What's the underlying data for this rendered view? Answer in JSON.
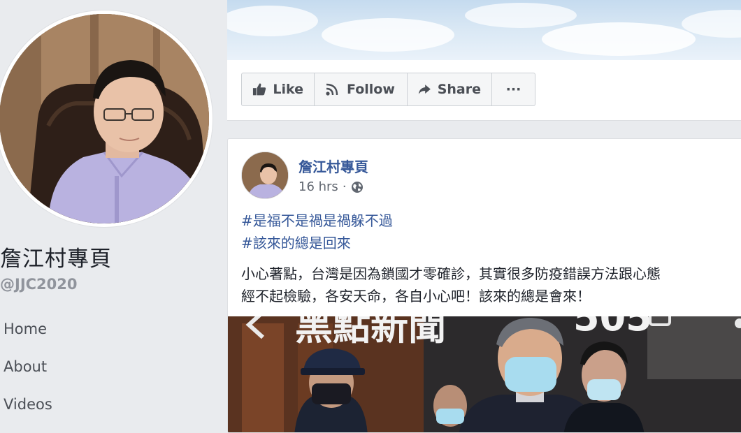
{
  "sidebar": {
    "page_name": "詹江村專頁",
    "handle": "@JJC2020",
    "nav": [
      "Home",
      "About",
      "Videos"
    ]
  },
  "actions": {
    "like": "Like",
    "follow": "Follow",
    "share": "Share",
    "more": "···"
  },
  "post": {
    "author": "詹江村專頁",
    "time": "16 hrs",
    "visibility_icon": "globe-icon",
    "hashtags": [
      "#是福不是禍是禍躲不過",
      "#該來的總是回來"
    ],
    "body_lines": [
      "小心著點，台灣是因為鎖國才零確診，其實很多防疫錯誤方法跟心態",
      "經不起檢驗，各安天命，各自小心吧！該來的總是會來！"
    ],
    "image_overlay": {
      "title": "黑點新聞",
      "count": "505"
    }
  },
  "colors": {
    "link": "#365899",
    "background": "#e9ebee",
    "button_text": "#4b4f56"
  }
}
